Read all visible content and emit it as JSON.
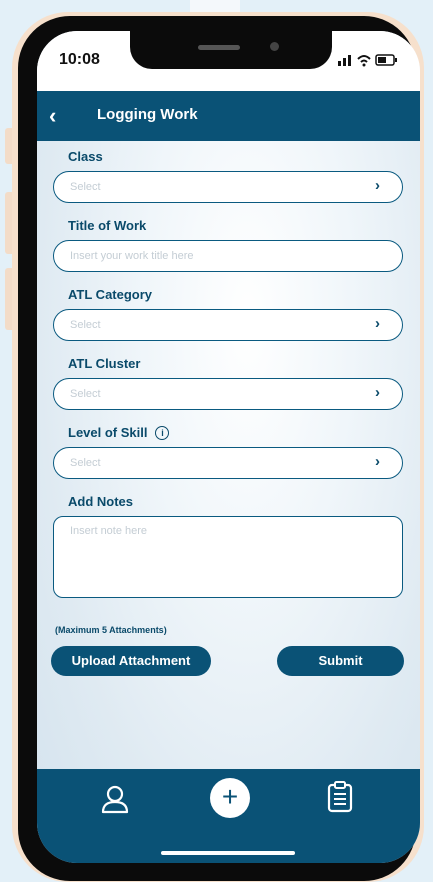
{
  "status": {
    "time": "10:08",
    "icons": "signal wifi battery"
  },
  "header": {
    "title": "Logging Work",
    "back_icon": "chevron-left-icon"
  },
  "form": {
    "class_label": "Class",
    "class_placeholder": "Select",
    "title_label": "Title of Work",
    "title_placeholder": "Insert your work title here",
    "atl_category_label": "ATL Category",
    "atl_category_placeholder": "Select",
    "atl_cluster_label": "ATL Cluster",
    "atl_cluster_placeholder": "Select",
    "skill_label": "Level of Skill",
    "skill_placeholder": "Select",
    "notes_label": "Add Notes",
    "notes_placeholder": "Insert note here",
    "max_attachments": "(Maximum 5 Attachments)",
    "upload_button": "Upload Attachment",
    "submit_button": "Submit"
  },
  "tabbar": {
    "icons": [
      "user-icon",
      "plus-icon",
      "clipboard-icon"
    ]
  },
  "colors": {
    "primary": "#0a5276",
    "label": "#0a4a6a"
  }
}
